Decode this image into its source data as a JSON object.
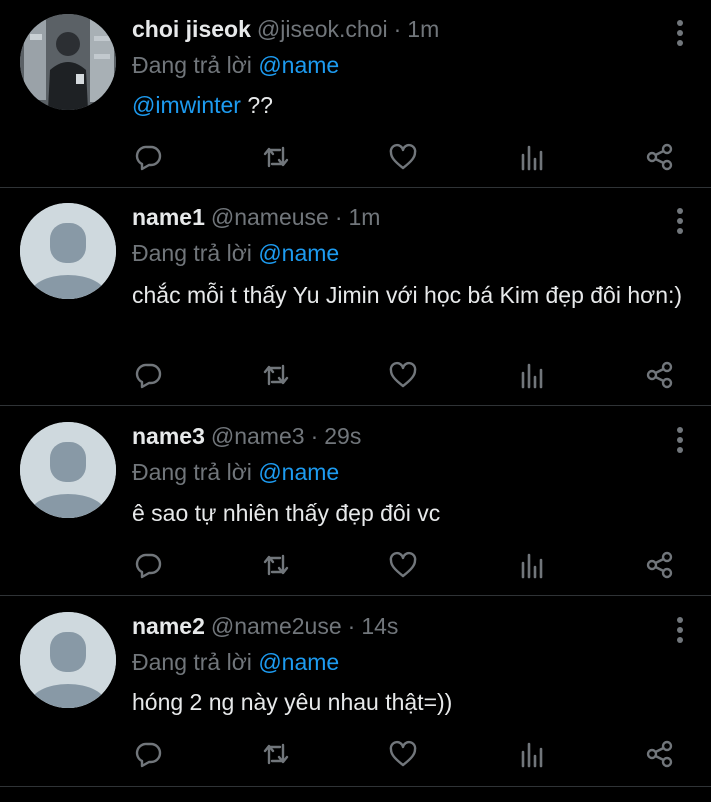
{
  "colors": {
    "background": "#000000",
    "text": "#e7e9ea",
    "muted": "#71767b",
    "accent": "#1d9bf0",
    "divider": "#2f3336",
    "default_avatar": "#cfd9de",
    "default_avatar_figure": "#8899a6"
  },
  "tweets": [
    {
      "display_name": "choi jiseok",
      "handle": "@jiseok.choi",
      "separator": "·",
      "time": "1m",
      "reply_prefix": "Đang trả lời",
      "reply_to": "@name",
      "mention": "@imwinter",
      "text": " ??",
      "avatar": "photo"
    },
    {
      "display_name": "name1",
      "handle": "@nameuse",
      "separator": "·",
      "time": "1m",
      "reply_prefix": "Đang trả lời",
      "reply_to": "@name",
      "text": "chắc mỗi t thấy Yu Jimin với học bá Kim đẹp đôi hơn:)",
      "avatar": "default"
    },
    {
      "display_name": "name3",
      "handle": "@name3",
      "separator": "·",
      "time": "29s",
      "reply_prefix": "Đang trả lời",
      "reply_to": "@name",
      "text": "ê sao tự nhiên thấy đẹp đôi vc",
      "avatar": "default"
    },
    {
      "display_name": "name2",
      "handle": "@name2use",
      "separator": "·",
      "time": "14s",
      "reply_prefix": "Đang trả lời",
      "reply_to": "@name",
      "text": "hóng 2 ng này yêu nhau thật=))",
      "avatar": "default"
    }
  ],
  "action_icons": [
    "reply-icon",
    "retweet-icon",
    "like-icon",
    "views-icon",
    "share-icon"
  ]
}
